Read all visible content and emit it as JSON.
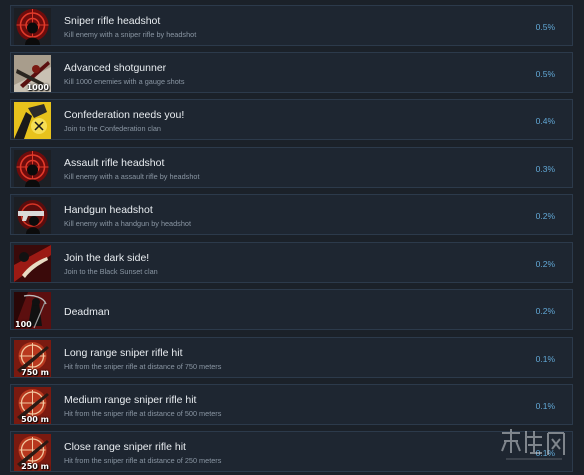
{
  "achievements": [
    {
      "title": "Sniper rifle headshot",
      "desc": "Kill enemy with a sniper rifle by headshot",
      "pct": "0.5%",
      "icon": "crosshair-head-icon"
    },
    {
      "title": "Advanced shotgunner",
      "desc": "Kill 1000 enemies with a gauge shots",
      "pct": "0.5%",
      "icon": "shotgun-icon",
      "badge": "1000"
    },
    {
      "title": "Confederation needs you!",
      "desc": "Join to the Confederation clan",
      "pct": "0.4%",
      "icon": "confederation-icon"
    },
    {
      "title": "Assault rifle headshot",
      "desc": "Kill enemy with a assault rifle by headshot",
      "pct": "0.3%",
      "icon": "crosshair-head-icon"
    },
    {
      "title": "Handgun headshot",
      "desc": "Kill enemy with a handgun by headshot",
      "pct": "0.2%",
      "icon": "handgun-head-icon"
    },
    {
      "title": "Join the dark side!",
      "desc": "Join to the Black Sunset clan",
      "pct": "0.2%",
      "icon": "dark-side-icon"
    },
    {
      "title": "Deadman",
      "desc": "",
      "pct": "0.2%",
      "icon": "reaper-icon",
      "badge": "100"
    },
    {
      "title": "Long range sniper rifle hit",
      "desc": "Hit from the sniper rifle at distance of 750 meters",
      "pct": "0.1%",
      "icon": "sniper-scope-icon",
      "badge": "750 m"
    },
    {
      "title": "Medium range sniper rifle hit",
      "desc": "Hit from the sniper rifle at distance of 500 meters",
      "pct": "0.1%",
      "icon": "sniper-scope-icon",
      "badge": "500 m"
    },
    {
      "title": "Close range sniper rifle hit",
      "desc": "Hit from the sniper rifle at distance of 250 meters",
      "pct": "0.1%",
      "icon": "sniper-scope-icon",
      "badge": "250 m"
    }
  ],
  "watermark": {
    "text": "游侠网",
    "icon": "watermark-logo-icon"
  },
  "colors": {
    "background": "#1b2129",
    "row_background": "#1e2631",
    "row_border": "#2c3a4b",
    "title": "#e9edf1",
    "description": "#8a96a3",
    "percent": "#62a8d6"
  }
}
